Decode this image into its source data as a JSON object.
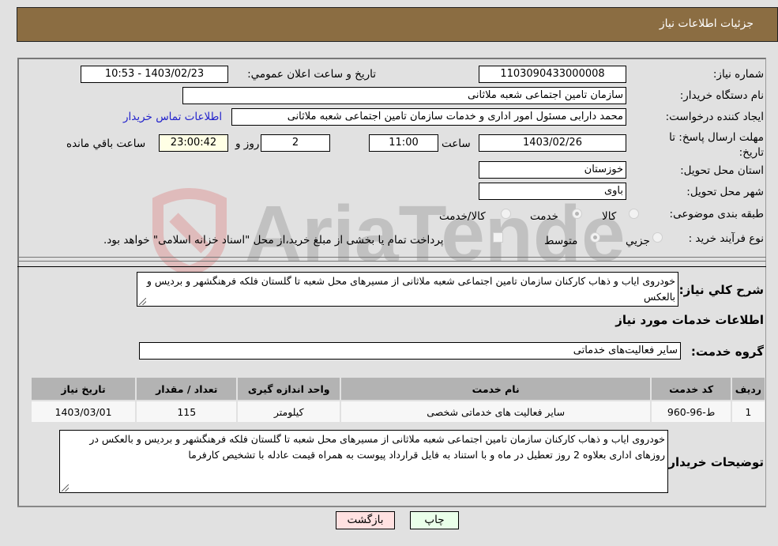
{
  "header": {
    "title": "جزئیات اطلاعات نیاز"
  },
  "form": {
    "need_number_label": "شماره نیاز:",
    "need_number": "1103090433000008",
    "announce_label": "تاریخ و ساعت اعلان عمومي:",
    "announce_value": "1403/02/23 - 10:53",
    "buyer_org_label": "نام دستگاه خریدار:",
    "buyer_org": "سازمان تامین اجتماعی شعبه ملاثانی",
    "creator_label": "ایجاد کننده درخواست:",
    "creator": "محمد دارابی مسئول امور اداری و خدمات سازمان تامین اجتماعی شعبه ملاثانی",
    "contact_link": "اطلاعات تماس خریدار",
    "deadline_label": "مهلت ارسال پاسخ: تا تاریخ:",
    "deadline_date": "1403/02/26",
    "time_label": "ساعت",
    "deadline_time": "11:00",
    "days_value": "2",
    "days_label": "روز و",
    "remaining_time": "23:00:42",
    "remaining_label": "ساعت باقي مانده",
    "province_label": "استان محل تحویل:",
    "province": "خوزستان",
    "city_label": "شهر محل تحویل:",
    "city": "باوی",
    "category_label": "طبقه بندی موضوعی:",
    "category_options": [
      {
        "label": "کالا",
        "checked": false
      },
      {
        "label": "خدمت",
        "checked": true
      },
      {
        "label": "کالا/خدمت",
        "checked": false
      }
    ],
    "process_label": "نوع فرآیند خرید :",
    "process_options": [
      {
        "label": "جزيي",
        "checked": false
      },
      {
        "label": "متوسط",
        "checked": true
      }
    ],
    "treasury_note": "پرداخت تمام یا بخشی از مبلغ خرید،از محل \"اسناد خزانه اسلامی\" خواهد بود.",
    "description_label": "شرح کلي نیاز:",
    "description": "خودروی ایاب و ذهاب کارکنان سازمان تامین اجتماعی شعبه ملاثانی از مسیرهای محل شعبه تا گلستان فلکه فرهنگشهر و بردیس و بالعکس"
  },
  "services": {
    "section_title": "اطلاعات خدمات مورد نیاز",
    "group_label": "گروه خدمت:",
    "group_value": "سایر فعالیت‌های خدماتی",
    "columns": [
      "ردیف",
      "کد خدمت",
      "نام خدمت",
      "واحد اندازه گیری",
      "تعداد / مقدار",
      "تاریخ نیاز"
    ],
    "rows": [
      [
        "1",
        "ط-96-960",
        "سایر فعالیت های خدماتی شخصی",
        "کیلومتر",
        "115",
        "1403/03/01"
      ]
    ]
  },
  "buyer_notes": {
    "label": "توضیحات خریدار:",
    "text": "خودروی ایاب و ذهاب کارکنان سازمان تامین اجتماعی شعبه ملاثانی از مسیرهای محل شعبه تا گلستان فلکه فرهنگشهر و بردیس و بالعکس در روزهای اداری بعلاوه 2 روز تعطیل در ماه و با استناد به فایل قرارداد پیوست به همراه قیمت عادله با تشخیص کارفرما"
  },
  "buttons": {
    "print": "چاپ",
    "back": "بازگشت"
  },
  "colors": {
    "header_bg": "#8b6d42",
    "back_btn_bg": "#ffe1e1",
    "print_btn_bg": "#eaffea",
    "link": "#2222cc"
  },
  "watermark": {
    "text": "AriaTender.neT"
  }
}
